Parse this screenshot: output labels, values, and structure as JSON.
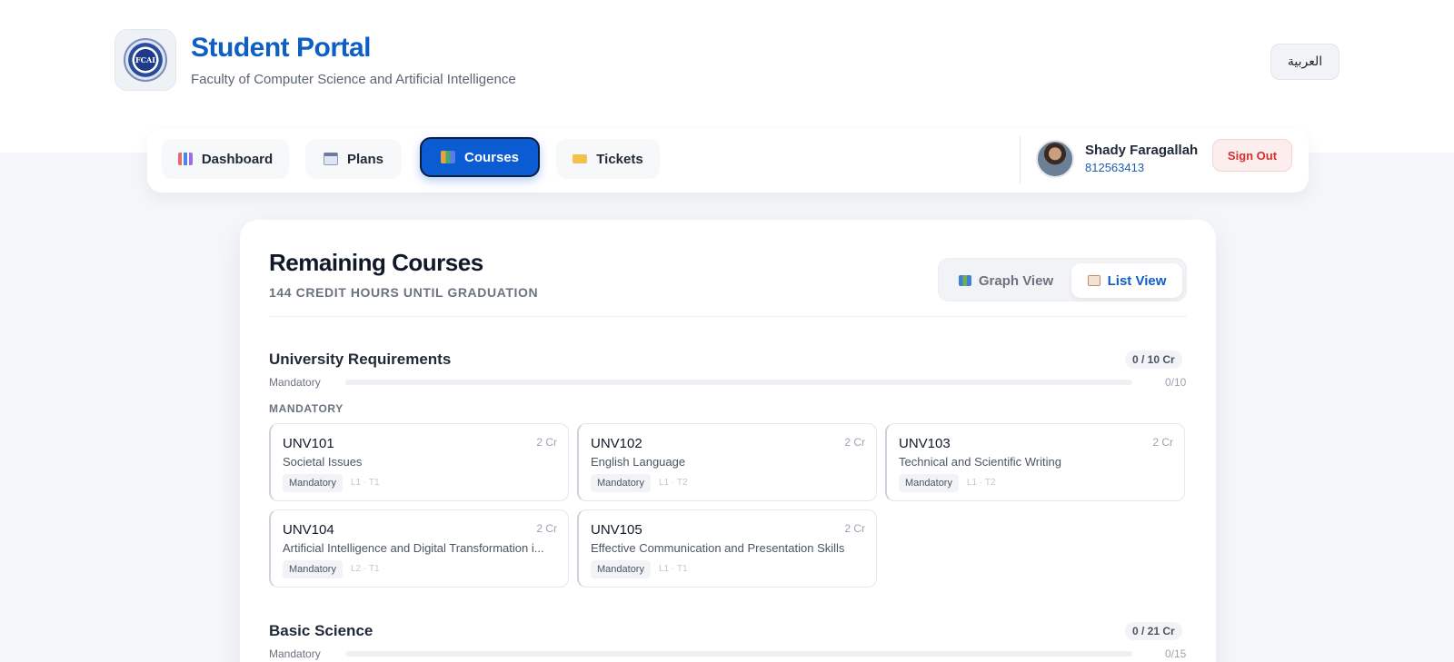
{
  "header": {
    "logo_text": "FCAI",
    "title": "Student Portal",
    "subtitle": "Faculty of Computer Science and Artificial Intelligence",
    "language_button": "العربية"
  },
  "nav": {
    "tabs": [
      {
        "label": "Dashboard",
        "icon": "bar-chart-icon",
        "active": false
      },
      {
        "label": "Plans",
        "icon": "calendar-icon",
        "active": false
      },
      {
        "label": "Courses",
        "icon": "books-icon",
        "active": true
      },
      {
        "label": "Tickets",
        "icon": "ticket-icon",
        "active": false
      }
    ],
    "user": {
      "name": "Shady Faragallah",
      "id": "812563413"
    },
    "sign_out": "Sign Out"
  },
  "main": {
    "title": "Remaining Courses",
    "subtitle": "144 CREDIT HOURS UNTIL GRADUATION",
    "view_toggle": {
      "graph": "Graph View",
      "list": "List View",
      "selected": "list"
    },
    "sections": [
      {
        "title": "University Requirements",
        "credits": "0 / 10 Cr",
        "progress_label": "Mandatory",
        "progress_count": "0/10",
        "progress_fraction": 0,
        "group_label": "MANDATORY",
        "courses": [
          {
            "code": "UNV101",
            "credits": "2 Cr",
            "name": "Societal Issues",
            "tag": "Mandatory",
            "term": "L1 · T1"
          },
          {
            "code": "UNV102",
            "credits": "2 Cr",
            "name": "English Language",
            "tag": "Mandatory",
            "term": "L1 · T2"
          },
          {
            "code": "UNV103",
            "credits": "2 Cr",
            "name": "Technical and Scientific Writing",
            "tag": "Mandatory",
            "term": "L1 · T2"
          },
          {
            "code": "UNV104",
            "credits": "2 Cr",
            "name": "Artificial Intelligence and Digital Transformation i...",
            "tag": "Mandatory",
            "term": "L2 · T1"
          },
          {
            "code": "UNV105",
            "credits": "2 Cr",
            "name": "Effective Communication and Presentation Skills",
            "tag": "Mandatory",
            "term": "L1 · T1"
          }
        ]
      },
      {
        "title": "Basic Science",
        "credits": "0 / 21 Cr",
        "progress_label": "Mandatory",
        "progress_count": "0/15",
        "progress_fraction": 0
      }
    ]
  },
  "colors": {
    "brand": "#0d5fc4",
    "active_tab": "#0b5bd3",
    "sign_out": "#d0312d",
    "background": "#f4f6f9"
  }
}
